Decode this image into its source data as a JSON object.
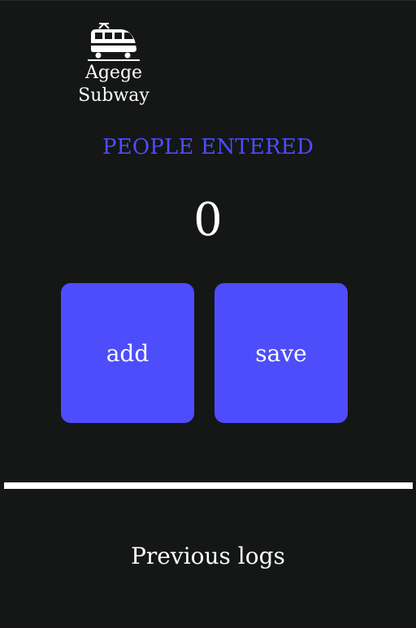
{
  "logo": {
    "icon": "train-icon",
    "text": "Agege Subway"
  },
  "counter": {
    "title": "PEOPLE ENTERED",
    "value": "0"
  },
  "buttons": {
    "add_label": "add",
    "save_label": "save"
  },
  "logs": {
    "title": "Previous logs"
  },
  "colors": {
    "background": "#151616",
    "accent": "#4d4dfc",
    "text": "#ffffff"
  }
}
